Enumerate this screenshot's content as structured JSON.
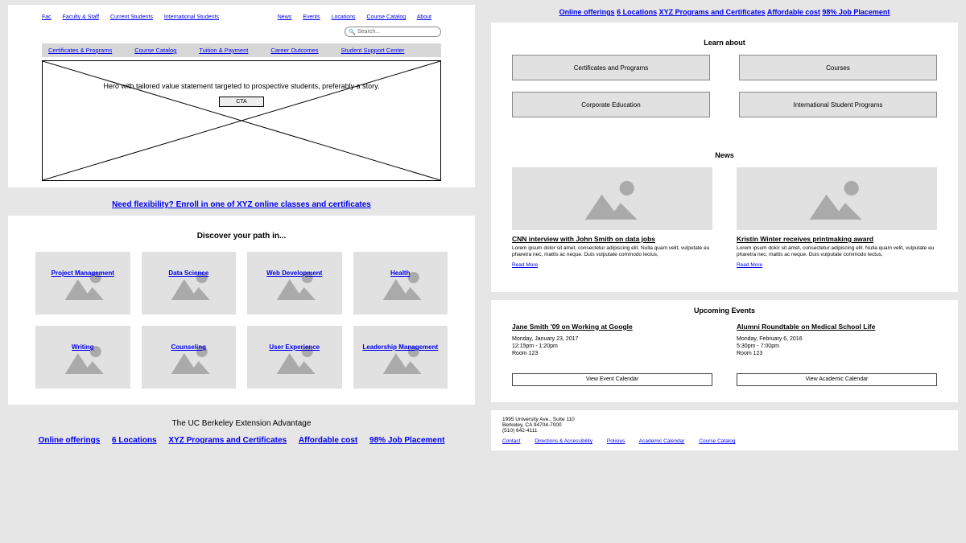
{
  "topnav_left": [
    "Fac",
    "Faculty & Staff",
    "Current Students",
    "International Students"
  ],
  "topnav_right": [
    "News",
    "Events",
    "Locations",
    "Course Catalog",
    "About"
  ],
  "search_placeholder": "Search...",
  "subnav": [
    "Certificates & Programs",
    "Course Catalog",
    "Tuition & Payment",
    "Career Outcomes",
    "Student Support Center"
  ],
  "hero_text": "Hero with tailored value statement targeted to prospective students, preferably a story.",
  "hero_cta": "CTA",
  "flex_headline": "Need flexibility? Enroll in one of XYZ online classes and certificates",
  "discover_title": "Discover your path in...",
  "tiles": [
    "Project Management",
    "Data Science",
    "Web Development",
    "Health",
    "Writing",
    "Counseling",
    "User Experience",
    "Leadership Management"
  ],
  "advantage_title": "The UC Berkeley Extension Advantage",
  "stats": [
    "Online offerings",
    "6 Locations",
    "XYZ Programs and Certificates",
    "Affordable cost",
    "98% Job Placement"
  ],
  "learn_title": "Learn about",
  "learn_buttons": [
    "Certificates and Programs",
    "Courses",
    "Corporate Education",
    "International Student Programs"
  ],
  "news_title": "News",
  "news": [
    {
      "title": "CNN interview with John Smith on data jobs",
      "body": "Lorem ipsum dolor sit amet, consectetur adipiscing elit. Nulla quam velit, vulputate eu pharetra nec, mattis ac neque. Duis vulputate commodo lectus,",
      "more": "Read More"
    },
    {
      "title": "Kristin Winter receives printmaking award",
      "body": "Lorem ipsum dolor sit amet, consectetur adipiscing elit. Nulla quam velit, vulputate eu pharetra nec, mattis ac neque. Duis vulputate commodo lectus,",
      "more": "Read More"
    }
  ],
  "events_title": "Upcoming Events",
  "events": [
    {
      "title": "Jane Smith '09 on Working at Google",
      "date": "Monday, January 23, 2017",
      "time": "12:15pm - 1:20pm",
      "room": "Room 123",
      "btn": "View Event Calendar"
    },
    {
      "title": "Alumni Roundtable on Medical School Life",
      "date": "Monday, February 6, 2016",
      "time": "5:30pm - 7:00pm",
      "room": "Room 123",
      "btn": "View Academic Calendar"
    }
  ],
  "footer_addr": [
    "1995 University Ave., Suite 110",
    "Berkeley, CA 94704-7000",
    "(510) 642-4111"
  ],
  "footer_links": [
    "Contact",
    "Directions & Accessibility",
    "Policies",
    "Academic Calendar",
    "Course Catalog"
  ]
}
